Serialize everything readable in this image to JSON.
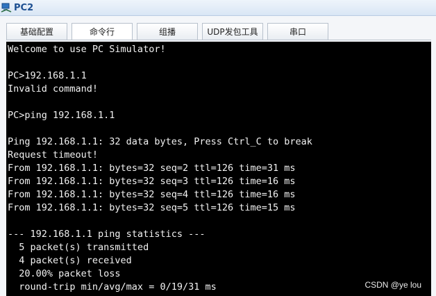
{
  "window": {
    "title": "PC2"
  },
  "tabs": [
    {
      "label": "基础配置"
    },
    {
      "label": "命令行"
    },
    {
      "label": "组播"
    },
    {
      "label": "UDP发包工具"
    },
    {
      "label": "串口"
    }
  ],
  "active_tab": "命令行",
  "terminal": {
    "lines": [
      "Welcome to use PC Simulator!",
      "",
      "PC>192.168.1.1",
      "Invalid command!",
      "",
      "PC>ping 192.168.1.1",
      "",
      "Ping 192.168.1.1: 32 data bytes, Press Ctrl_C to break",
      "Request timeout!",
      "From 192.168.1.1: bytes=32 seq=2 ttl=126 time=31 ms",
      "From 192.168.1.1: bytes=32 seq=3 ttl=126 time=16 ms",
      "From 192.168.1.1: bytes=32 seq=4 ttl=126 time=16 ms",
      "From 192.168.1.1: bytes=32 seq=5 ttl=126 time=15 ms",
      "",
      "--- 192.168.1.1 ping statistics ---",
      "  5 packet(s) transmitted",
      "  4 packet(s) received",
      "  20.00% packet loss",
      "  round-trip min/avg/max = 0/19/31 ms"
    ]
  },
  "watermark": "CSDN @ye  lou",
  "icons": {
    "app": "pc-app-icon"
  },
  "colors": {
    "terminal_bg": "#000000",
    "terminal_fg": "#f2f2f2",
    "title": "#1d4f91"
  }
}
